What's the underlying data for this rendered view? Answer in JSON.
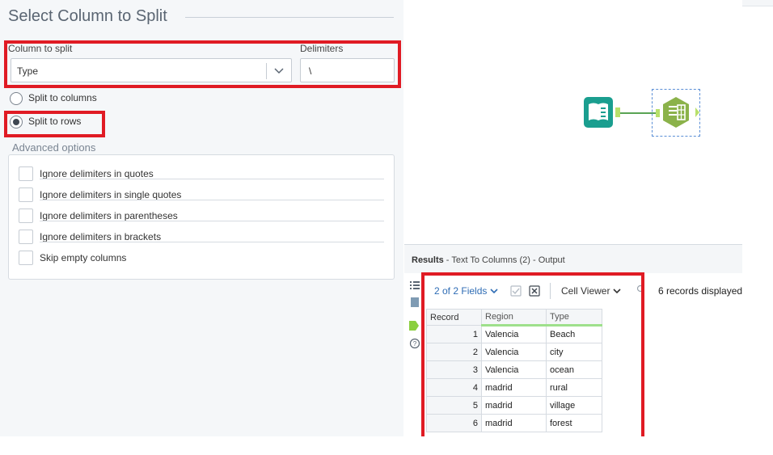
{
  "config": {
    "section_title": "Select Column to Split",
    "column_to_split_label": "Column to split",
    "column_to_split_value": "Type",
    "delimiters_label": "Delimiters",
    "delimiters_value": "\\",
    "split_to_columns_label": "Split to columns",
    "split_to_rows_label": "Split to rows",
    "selected_mode": "Split to rows",
    "advanced_title": "Advanced options",
    "advanced_options": [
      {
        "label": "Ignore delimiters in quotes",
        "checked": false
      },
      {
        "label": "Ignore delimiters in single quotes",
        "checked": false
      },
      {
        "label": "Ignore delimiters in parentheses",
        "checked": false
      },
      {
        "label": "Ignore delimiters in brackets",
        "checked": false
      },
      {
        "label": "Skip empty columns",
        "checked": false
      }
    ]
  },
  "results": {
    "title_bold": "Results",
    "title_rest": " - Text To Columns (2) - Output",
    "fields_label": "2 of 2 Fields",
    "viewer_label": "Cell Viewer",
    "records_displayed": "6 records displayed",
    "columns": [
      "Record",
      "Region",
      "Type"
    ],
    "rows": [
      {
        "record": "1",
        "region": "Valencia",
        "type": "Beach"
      },
      {
        "record": "2",
        "region": "Valencia",
        "type": "city"
      },
      {
        "record": "3",
        "region": "Valencia",
        "type": "ocean"
      },
      {
        "record": "4",
        "region": "madrid",
        "type": "rural"
      },
      {
        "record": "5",
        "region": "madrid",
        "type": "village"
      },
      {
        "record": "6",
        "region": "madrid",
        "type": "forest"
      }
    ]
  },
  "colors": {
    "highlight_red": "#e01b24",
    "link_blue": "#2f6db5",
    "input_tool_teal": "#1a9e8f",
    "text_to_columns_green": "#8bb24a",
    "connector_green": "#5aa454"
  },
  "icons": {
    "input_tool": "book-input-icon",
    "text_to_columns_tool": "text-to-columns-icon"
  }
}
